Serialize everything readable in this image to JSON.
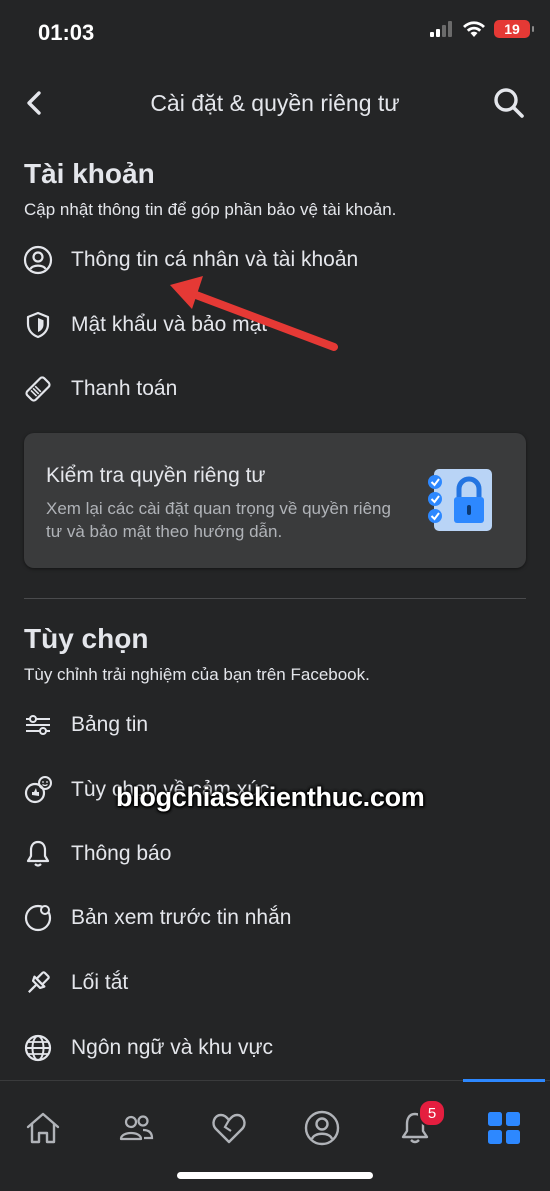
{
  "status": {
    "time": "01:03",
    "battery": "19"
  },
  "nav": {
    "title": "Cài đặt & quyền riêng tư"
  },
  "account": {
    "title": "Tài khoản",
    "subtitle": "Cập nhật thông tin để góp phần bảo vệ tài khoản.",
    "items": [
      {
        "label": "Thông tin cá nhân và tài khoản",
        "icon": "person-circle-icon"
      },
      {
        "label": "Mật khẩu và bảo mật",
        "icon": "shield-icon"
      },
      {
        "label": "Thanh toán",
        "icon": "payment-tag-icon"
      }
    ]
  },
  "privacy_card": {
    "title": "Kiểm tra quyền riêng tư",
    "description": "Xem lại các cài đặt quan trọng về quyền riêng tư và bảo mật theo hướng dẫn."
  },
  "preferences": {
    "title": "Tùy chọn",
    "subtitle": "Tùy chỉnh trải nghiệm của bạn trên Facebook.",
    "items": [
      {
        "label": "Bảng tin",
        "icon": "sliders-icon"
      },
      {
        "label": "Tùy chọn về cảm xúc",
        "icon": "reaction-icon"
      },
      {
        "label": "Thông báo",
        "icon": "bell-icon"
      },
      {
        "label": "Bản xem trước tin nhắn",
        "icon": "message-preview-icon"
      },
      {
        "label": "Lối tắt",
        "icon": "pin-icon"
      },
      {
        "label": "Ngôn ngữ và khu vực",
        "icon": "globe-icon"
      }
    ]
  },
  "watermark": "blogchiasekienthuc.com",
  "tabbar": {
    "notification_badge": "5",
    "active_tab": "menu",
    "accent": "#2d88ff"
  }
}
